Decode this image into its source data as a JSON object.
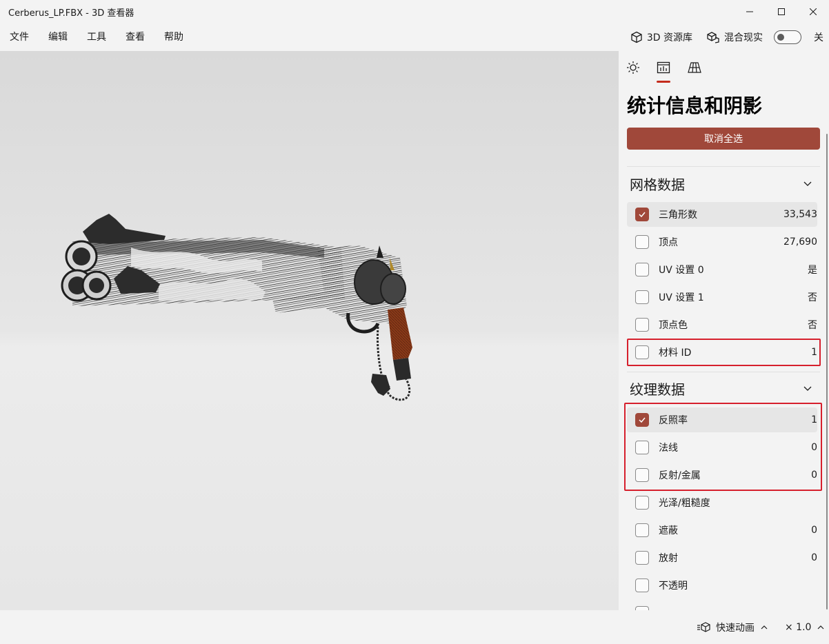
{
  "window": {
    "title": "Cerberus_LP.FBX - 3D 查看器"
  },
  "menu": {
    "items": [
      "文件",
      "编辑",
      "工具",
      "查看",
      "帮助"
    ],
    "library_label": "3D 资源库",
    "mixed_reality_label": "混合现实",
    "toggle_state": "关"
  },
  "panel": {
    "title": "统计信息和阴影",
    "deselect_all": "取消全选",
    "accent_color": "#a0483a",
    "mesh_section": {
      "label": "网格数据",
      "rows": [
        {
          "label": "三角形数",
          "value": "33,543",
          "checked": true
        },
        {
          "label": "顶点",
          "value": "27,690",
          "checked": false
        },
        {
          "label": "UV 设置 0",
          "value": "是",
          "checked": false
        },
        {
          "label": "UV 设置 1",
          "value": "否",
          "checked": false
        },
        {
          "label": "顶点色",
          "value": "否",
          "checked": false
        },
        {
          "label": "材料 ID",
          "value": "1",
          "checked": false
        }
      ]
    },
    "texture_section": {
      "label": "纹理数据",
      "rows": [
        {
          "label": "反照率",
          "value": "1",
          "checked": true
        },
        {
          "label": "法线",
          "value": "0",
          "checked": false
        },
        {
          "label": "反射/金属",
          "value": "0",
          "checked": false
        },
        {
          "label": "光泽/粗糙度",
          "value": "",
          "checked": false
        },
        {
          "label": "遮蔽",
          "value": "0",
          "checked": false
        },
        {
          "label": "放射",
          "value": "0",
          "checked": false
        },
        {
          "label": "不透明",
          "value": "",
          "checked": false
        }
      ]
    }
  },
  "status": {
    "animation_label": "快速动画",
    "speed": "× 1.0"
  }
}
